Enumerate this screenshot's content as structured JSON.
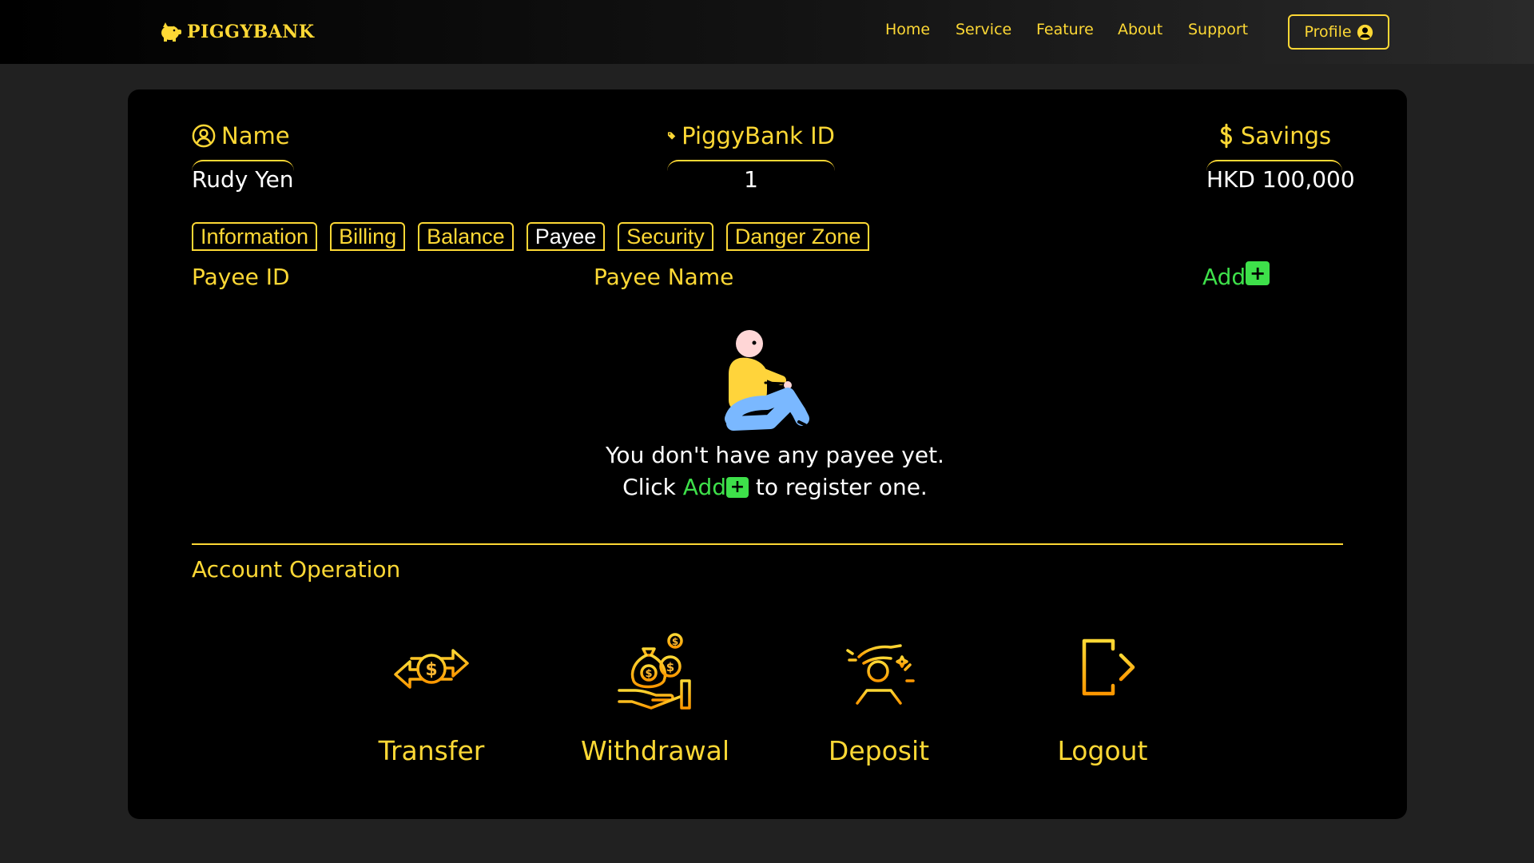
{
  "brand": {
    "name": "PIGGYBANK"
  },
  "nav": {
    "links": [
      "Home",
      "Service",
      "Feature",
      "About",
      "Support"
    ],
    "profile_label": "Profile"
  },
  "account": {
    "name_label": "Name",
    "name_value": "Rudy Yen",
    "id_label": "PiggyBank ID",
    "id_value": "1",
    "savings_label": "Savings",
    "savings_value": "HKD 100,000"
  },
  "tabs": [
    {
      "label": "Information",
      "active": false
    },
    {
      "label": "Billing",
      "active": false
    },
    {
      "label": "Balance",
      "active": false
    },
    {
      "label": "Payee",
      "active": true
    },
    {
      "label": "Security",
      "active": false
    },
    {
      "label": "Danger Zone",
      "active": false
    }
  ],
  "payee_table": {
    "col_id": "Payee ID",
    "col_name": "Payee Name",
    "add_label": "Add",
    "add_symbol": "+"
  },
  "empty_state": {
    "line1": "You don't have any payee yet.",
    "line2_prefix": "Click",
    "line2_add": "Add",
    "line2_suffix": "to register one."
  },
  "operations": {
    "title": "Account Operation",
    "items": [
      {
        "label": "Transfer",
        "icon": "transfer-icon"
      },
      {
        "label": "Withdrawal",
        "icon": "withdrawal-icon"
      },
      {
        "label": "Deposit",
        "icon": "deposit-icon"
      },
      {
        "label": "Logout",
        "icon": "logout-icon"
      }
    ]
  },
  "colors": {
    "accent": "#fdd835",
    "add_green": "#3ee04a",
    "card_bg": "#000000",
    "page_bg": "#212121"
  }
}
